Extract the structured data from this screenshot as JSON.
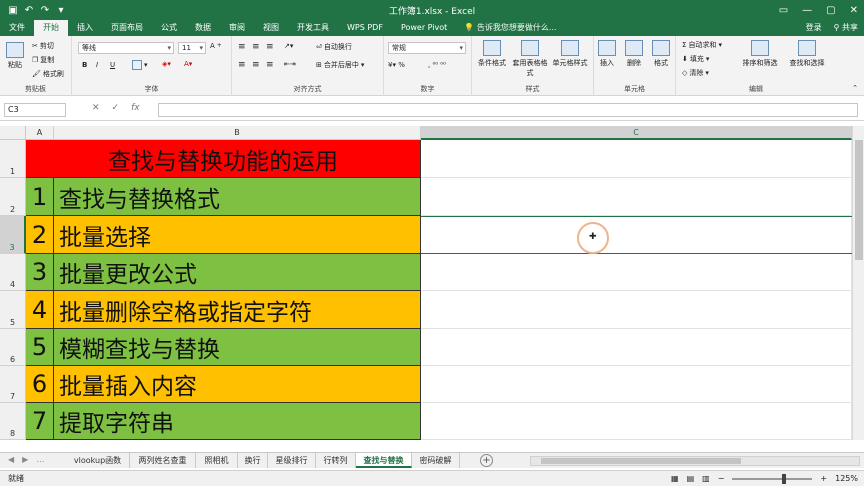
{
  "window": {
    "title": "工作簿1.xlsx - Excel",
    "quick_access": [
      "save-icon",
      "undo-icon",
      "redo-icon",
      "customize-icon"
    ]
  },
  "ribbon_tabs": [
    "文件",
    "开始",
    "插入",
    "页面布局",
    "公式",
    "数据",
    "审阅",
    "视图",
    "开发工具",
    "WPS PDF",
    "Power Pivot"
  ],
  "active_tab": "开始",
  "tell_me": "告诉我您想要做什么...",
  "account": {
    "login": "登录",
    "share": "共享"
  },
  "ribbon": {
    "clipboard": {
      "label": "剪贴板",
      "paste": "粘贴",
      "cut": "剪切",
      "copy": "复制",
      "format_painter": "格式刷"
    },
    "font": {
      "label": "字体",
      "font_name": "等线",
      "font_size": "11",
      "bold": "B",
      "italic": "I",
      "underline": "U"
    },
    "alignment": {
      "label": "对齐方式",
      "wrap": "自动换行",
      "merge": "合并后居中"
    },
    "number": {
      "label": "数字",
      "format": "常规"
    },
    "styles": {
      "label": "样式",
      "conditional": "条件格式",
      "table": "套用表格格式",
      "cell_styles": "单元格样式"
    },
    "cells": {
      "label": "单元格",
      "insert": "插入",
      "delete": "删除",
      "format": "格式"
    },
    "editing": {
      "label": "编辑",
      "autosum": "自动求和",
      "fill": "填充",
      "clear": "清除",
      "sort": "排序和筛选",
      "find": "查找和选择"
    }
  },
  "formula_bar": {
    "name_box": "C3",
    "value": ""
  },
  "columns": [
    "A",
    "B",
    "C"
  ],
  "selected_column": "C",
  "rows": [
    "1",
    "2",
    "3",
    "4",
    "5",
    "6",
    "7",
    "8"
  ],
  "selected_row": "3",
  "sheet_title": "查找与替换功能的运用",
  "items": [
    {
      "num": "1",
      "text": "查找与替换格式",
      "color": "#7ec142"
    },
    {
      "num": "2",
      "text": "批量选择",
      "color": "#ffc000"
    },
    {
      "num": "3",
      "text": "批量更改公式",
      "color": "#7ec142"
    },
    {
      "num": "4",
      "text": "批量删除空格或指定字符",
      "color": "#ffc000"
    },
    {
      "num": "5",
      "text": "模糊查找与替换",
      "color": "#7ec142"
    },
    {
      "num": "6",
      "text": "批量插入内容",
      "color": "#ffc000"
    },
    {
      "num": "7",
      "text": "提取字符串",
      "color": "#7ec142"
    }
  ],
  "sheet_tabs": [
    "vlookup函数",
    "两列姓名查重",
    "照相机",
    "换行",
    "星级排行",
    "行转列",
    "查找与替换",
    "密码破解"
  ],
  "active_sheet": "查找与替换",
  "status": {
    "ready": "就绪",
    "zoom": "125%"
  }
}
